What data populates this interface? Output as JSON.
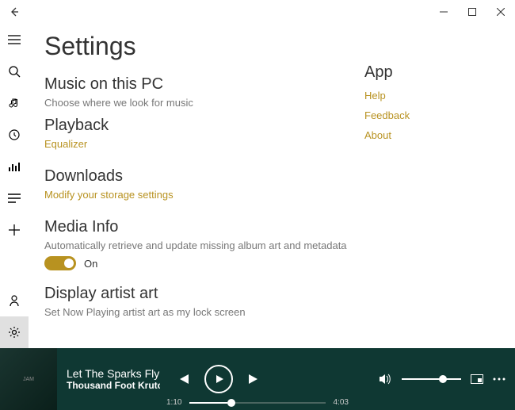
{
  "page": {
    "title": "Settings"
  },
  "sections": {
    "music": {
      "title": "Music on this PC",
      "desc": "Choose where we look for music"
    },
    "playback": {
      "title": "Playback",
      "link": "Equalizer"
    },
    "downloads": {
      "title": "Downloads",
      "link": "Modify your storage settings"
    },
    "media": {
      "title": "Media Info",
      "desc": "Automatically retrieve and update missing album art and metadata",
      "toggle": "On"
    },
    "display": {
      "title": "Display artist art",
      "desc": "Set Now Playing artist art as my lock screen"
    }
  },
  "app": {
    "title": "App",
    "help": "Help",
    "feedback": "Feedback",
    "about": "About"
  },
  "player": {
    "track": "Let The Sparks Fly",
    "artist": "Thousand Foot Krutch",
    "elapsed": "1:10",
    "total": "4:03"
  }
}
